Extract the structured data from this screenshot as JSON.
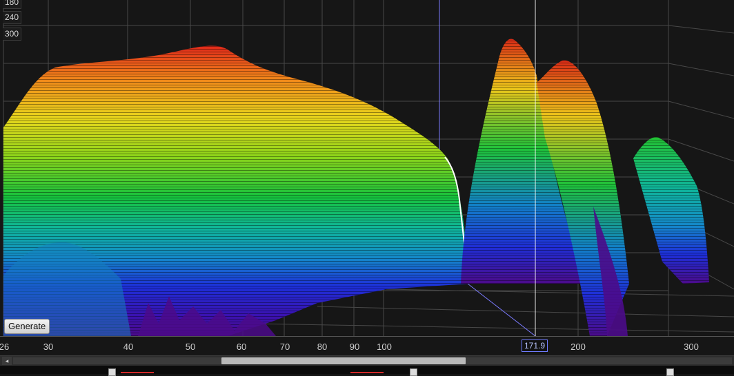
{
  "window": {
    "view": "waterfall-3d"
  },
  "z_axis": {
    "labels": [
      "180",
      "240",
      "300"
    ]
  },
  "x_axis": {
    "scale": "log",
    "unit": "Hz",
    "ticks": [
      "26",
      "30",
      "40",
      "50",
      "60",
      "70",
      "80",
      "90",
      "100",
      "200",
      "300"
    ],
    "tick_values": [
      26,
      30,
      40,
      50,
      60,
      70,
      80,
      90,
      100,
      200,
      300
    ],
    "min": 26,
    "max": 330
  },
  "cursor": {
    "value": 171.9,
    "readout": "171.9",
    "color": "#6f7cff"
  },
  "controls": {
    "generate_label": "Generate"
  },
  "scrollbar": {
    "left_arrow": "◂",
    "thumb_start_fraction": 0.29,
    "thumb_end_fraction": 0.63
  },
  "colors": {
    "background": "#161616",
    "grid": "#4a4a4a",
    "gradient_top": "#e0291a",
    "gradient_bottom": "#4b0b8a",
    "reference_line": "#ffffff",
    "bottom_check_red": "#d42a2a"
  },
  "bottom_bar": {
    "checkbox_count": 3
  }
}
